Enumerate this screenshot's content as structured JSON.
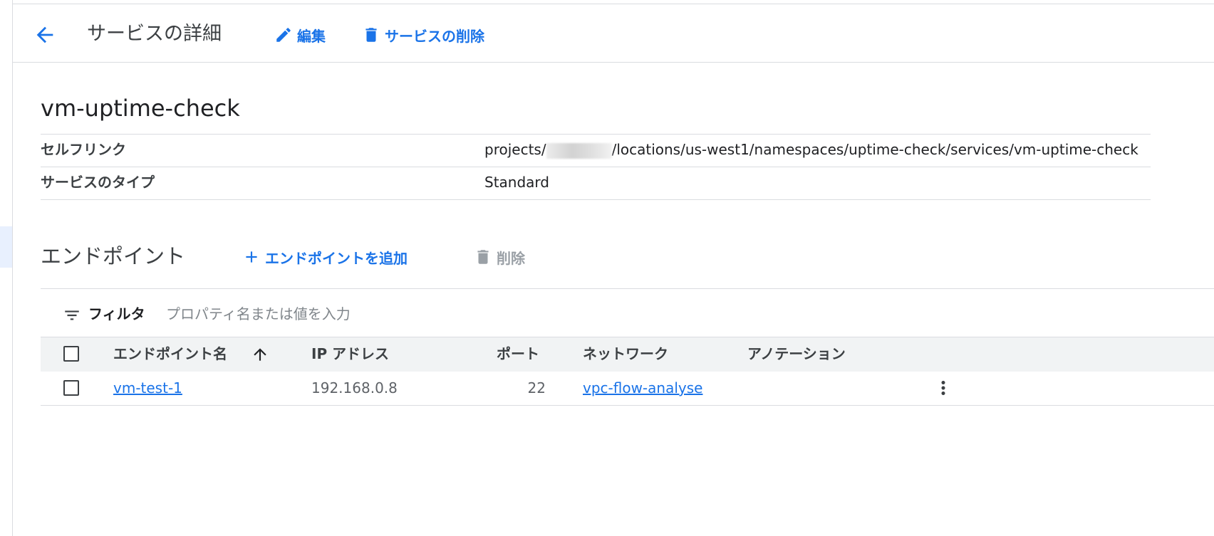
{
  "header": {
    "title": "サービスの詳細",
    "edit_label": "編集",
    "delete_service_label": "サービスの削除"
  },
  "service": {
    "name": "vm-uptime-check",
    "details": [
      {
        "key": "セルフリンク",
        "value_prefix": "projects/",
        "value_suffix": "/locations/us-west1/namespaces/uptime-check/services/vm-uptime-check"
      },
      {
        "key": "サービスのタイプ",
        "value": "Standard"
      }
    ]
  },
  "endpoints": {
    "title": "エンドポイント",
    "add_label": "エンドポイントを追加",
    "delete_label": "削除",
    "filter": {
      "label": "フィルタ",
      "placeholder": "プロパティ名または値を入力"
    },
    "columns": [
      "エンドポイント名",
      "IP アドレス",
      "ポート",
      "ネットワーク",
      "アノテーション"
    ],
    "sort": {
      "column": "エンドポイント名",
      "direction": "ascending"
    },
    "rows": [
      {
        "name": "vm-test-1",
        "ip": "192.168.0.8",
        "port": "22",
        "network": "vpc-flow-analyse",
        "annotation": ""
      }
    ]
  },
  "icons": {
    "back": "arrow-back-icon",
    "edit": "pencil-icon",
    "delete": "trash-icon",
    "add": "plus-icon",
    "filter": "filter-list-icon",
    "sort": "arrow-up-icon",
    "more": "more-vert-icon"
  },
  "colors": {
    "accent": "#1a73e8",
    "disabled": "#9aa0a6",
    "header_bg": "#f1f3f4",
    "border": "#dadce0"
  }
}
